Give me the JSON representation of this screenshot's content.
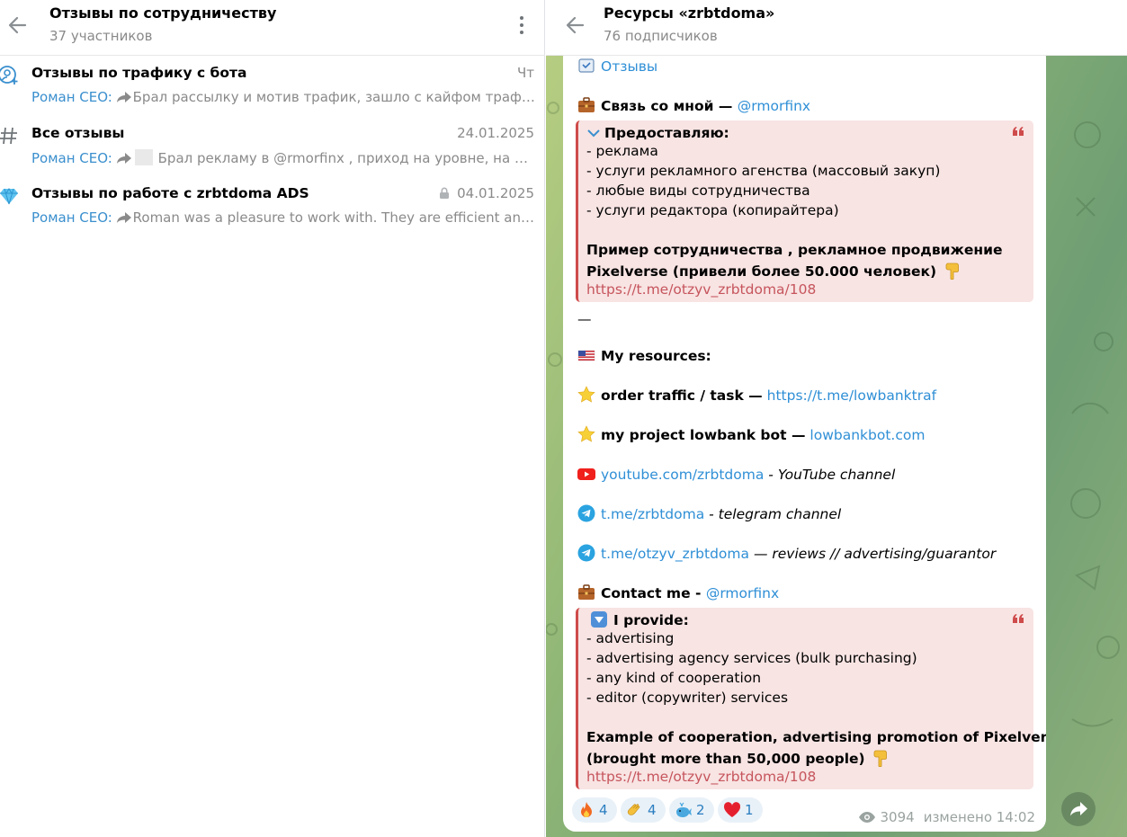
{
  "left": {
    "title": "Отзывы по сотрудничеству",
    "subtitle": "37 участников",
    "topics": [
      {
        "icon": "user-plus-icon",
        "name": "Отзывы по трафику с бота",
        "date": "Чт",
        "sender": "Роман CEO:",
        "preview": "Брал рассылку и мотив трафик, зашло с кайфом трафик, очень рекомендую",
        "locked": false
      },
      {
        "icon": "hash-icon",
        "name": "Все отзывы",
        "date": "24.01.2025",
        "sender": "Роман CEO:",
        "preview": "Брал рекламу в @rmorfinx , приход на уровне, на отлично",
        "locked": false
      },
      {
        "icon": "diamond-icon",
        "name": "Отзывы по работе с zrbtdoma ADS",
        "date": "04.01.2025",
        "sender": "Роман CEO:",
        "preview": "Roman was a pleasure to work with. They are efficient and professional",
        "locked": true
      }
    ]
  },
  "right": {
    "title": "Ресурсы «zrbtdoma»",
    "subtitle": "76 подписчиков",
    "message": {
      "reviews_link": "Отзывы",
      "contact_ru_label": "Связь со мной —",
      "contact_ru_handle": "@rmorfinx",
      "quote_ru": {
        "title": "Предоставляю:",
        "items": [
          "- реклама",
          "- услуги рекламного агенства (массовый закуп)",
          "- любые виды сотрудничества",
          "- услуги редактора (копирайтера)"
        ],
        "example_line1": "Пример сотрудничества , рекламное продвижение",
        "example_line2": "Pixelverse (привели более 50.000 человек)",
        "link": "https://t.me/otzyv_zrbtdoma/108"
      },
      "divider": "—",
      "resources_label": "My resources:",
      "order_label": "order traffic / task —",
      "order_link": "https://t.me/lowbanktraf",
      "project_label": "my project lowbank bot —",
      "project_link": "lowbankbot.com",
      "youtube_link": "youtube.com/zrbtdoma",
      "youtube_desc": "- YouTube channel",
      "telegram_link": "t.me/zrbtdoma",
      "telegram_desc": "- telegram channel",
      "reviews_tg_link": "t.me/otzyv_zrbtdoma",
      "reviews_tg_desc": "— reviews // advertising/guarantor",
      "contact_en_label": "Contact me -",
      "contact_en_handle": "@rmorfinx",
      "quote_en": {
        "title": "I provide:",
        "items": [
          "- advertising",
          "- advertising agency services (bulk purchasing)",
          "- any kind of cooperation",
          "- editor (copywriter) services"
        ],
        "example_line1": "Example of cooperation, advertising promotion of Pixelverse",
        "example_line2": "(brought more than 50,000 people)",
        "link": "https://t.me/otzyv_zrbtdoma/108"
      },
      "reactions": [
        {
          "emoji": "fire",
          "count": "4"
        },
        {
          "emoji": "clap",
          "count": "4"
        },
        {
          "emoji": "whale",
          "count": "2"
        },
        {
          "emoji": "heart",
          "count": "1"
        }
      ],
      "views": "3094",
      "edited": "изменено 14:02"
    }
  },
  "colors": {
    "accent": "#3a8fce",
    "quote_border": "#cf4b4b",
    "quote_bg": "#f8e4e3"
  }
}
